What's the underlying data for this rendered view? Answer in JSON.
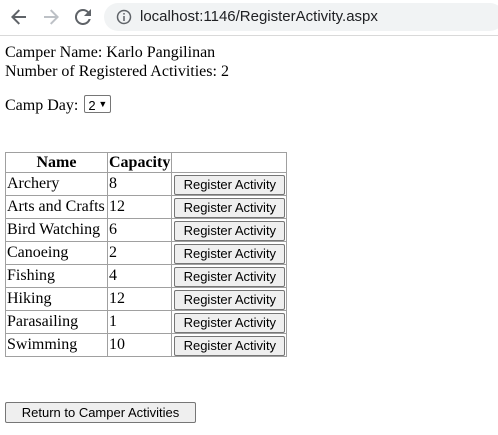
{
  "browser": {
    "url": "localhost:1146/RegisterActivity.aspx",
    "icons": {
      "back": "back-arrow-icon",
      "forward": "forward-arrow-icon",
      "reload": "reload-icon",
      "info": "info-icon"
    }
  },
  "camper": {
    "name_text": "Camper Name: Karlo Pangilinan",
    "count_text": "Number of Registered Activities: 2"
  },
  "camp_day": {
    "label": "Camp Day:",
    "selected": "2"
  },
  "activities": {
    "headers": [
      "Name",
      "Capacity",
      ""
    ],
    "button_label": "Register Activity",
    "rows": [
      {
        "name": "Archery",
        "capacity": "8"
      },
      {
        "name": "Arts and Crafts",
        "capacity": "12"
      },
      {
        "name": "Bird Watching",
        "capacity": "6"
      },
      {
        "name": "Canoeing",
        "capacity": "2"
      },
      {
        "name": "Fishing",
        "capacity": "4"
      },
      {
        "name": "Hiking",
        "capacity": "12"
      },
      {
        "name": "Parasailing",
        "capacity": "1"
      },
      {
        "name": "Swimming",
        "capacity": "10"
      }
    ]
  },
  "return_button": "Return to Camper Activities"
}
